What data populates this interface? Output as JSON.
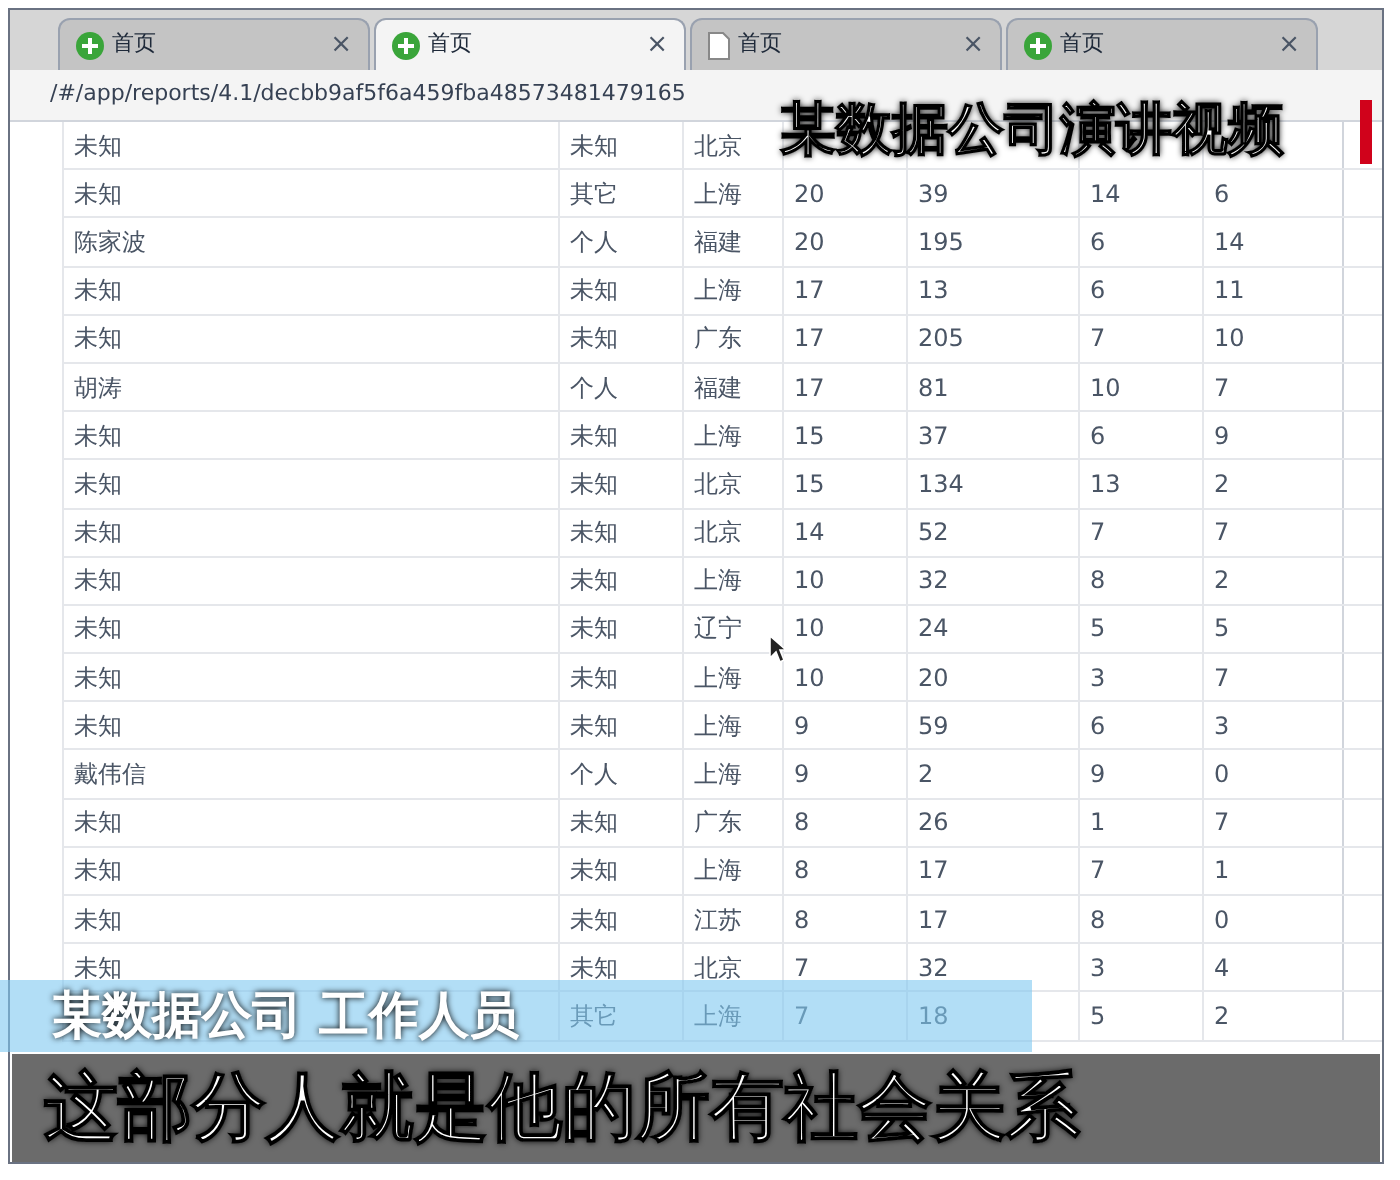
{
  "tabs": [
    {
      "label": "首页",
      "kind": "plus",
      "close": "×",
      "selected": false
    },
    {
      "label": "首页",
      "kind": "plus",
      "close": "×",
      "selected": true
    },
    {
      "label": "首页",
      "kind": "page",
      "close": "×",
      "selected": false
    },
    {
      "label": "首页",
      "kind": "plus",
      "close": "×",
      "selected": false
    }
  ],
  "address_bar": {
    "value": "/#/app/reports/4.1/decbb9af5f6a459fba48573481479165"
  },
  "table": {
    "rows": [
      {
        "column_1": "未知",
        "column_2": "未知",
        "column_3": "北京"
      },
      {
        "column_1": "未知",
        "column_2": "其它",
        "column_3": "上海",
        "column_4": "20",
        "column_5": "39",
        "column_6": "14",
        "column_7": "6"
      },
      {
        "column_1": "陈家波",
        "column_2": "个人",
        "column_3": "福建",
        "column_4": "20",
        "column_5": "195",
        "column_6": "6",
        "column_7": "14"
      },
      {
        "column_1": "未知",
        "column_2": "未知",
        "column_3": "上海",
        "column_4": "17",
        "column_5": "13",
        "column_6": "6",
        "column_7": "11"
      },
      {
        "column_1": "未知",
        "column_2": "未知",
        "column_3": "广东",
        "column_4": "17",
        "column_5": "205",
        "column_6": "7",
        "column_7": "10"
      },
      {
        "column_1": "胡涛",
        "column_2": "个人",
        "column_3": "福建",
        "column_4": "17",
        "column_5": "81",
        "column_6": "10",
        "column_7": "7"
      },
      {
        "column_1": "未知",
        "column_2": "未知",
        "column_3": "上海",
        "column_4": "15",
        "column_5": "37",
        "column_6": "6",
        "column_7": "9"
      },
      {
        "column_1": "未知",
        "column_2": "未知",
        "column_3": "北京",
        "column_4": "15",
        "column_5": "134",
        "column_6": "13",
        "column_7": "2"
      },
      {
        "column_1": "未知",
        "column_2": "未知",
        "column_3": "北京",
        "column_4": "14",
        "column_5": "52",
        "column_6": "7",
        "column_7": "7"
      },
      {
        "column_1": "未知",
        "column_2": "未知",
        "column_3": "上海",
        "column_4": "10",
        "column_5": "32",
        "column_6": "8",
        "column_7": "2"
      },
      {
        "column_1": "未知",
        "column_2": "未知",
        "column_3": "辽宁",
        "column_4": "10",
        "column_5": "24",
        "column_6": "5",
        "column_7": "5"
      },
      {
        "column_1": "未知",
        "column_2": "未知",
        "column_3": "上海",
        "column_4": "10",
        "column_5": "20",
        "column_6": "3",
        "column_7": "7"
      },
      {
        "column_1": "未知",
        "column_2": "未知",
        "column_3": "上海",
        "column_4": "9",
        "column_5": "59",
        "column_6": "6",
        "column_7": "3"
      },
      {
        "column_1": "戴伟信",
        "column_2": "个人",
        "column_3": "上海",
        "column_4": "9",
        "column_5": "2",
        "column_6": "9",
        "column_7": "0"
      },
      {
        "column_1": "未知",
        "column_2": "未知",
        "column_3": "广东",
        "column_4": "8",
        "column_5": "26",
        "column_6": "1",
        "column_7": "7"
      },
      {
        "column_1": "未知",
        "column_2": "未知",
        "column_3": "上海",
        "column_4": "8",
        "column_5": "17",
        "column_6": "7",
        "column_7": "1"
      },
      {
        "column_1": "未知",
        "column_2": "未知",
        "column_3": "江苏",
        "column_4": "8",
        "column_5": "17",
        "column_6": "8",
        "column_7": "0"
      },
      {
        "column_1": "未知",
        "column_2": "未知",
        "column_3": "北京",
        "column_4": "7",
        "column_5": "32",
        "column_6": "3",
        "column_7": "4"
      },
      {
        "column_2": "其它",
        "column_3": "上海",
        "column_4": "7",
        "column_5": "18",
        "column_6": "5",
        "column_7": "2"
      }
    ]
  },
  "captions": {
    "top": "某数据公司演讲视频",
    "speaker": "某数据公司 工作人员",
    "subtitle": "这部分人就是他的所有社会关系"
  }
}
